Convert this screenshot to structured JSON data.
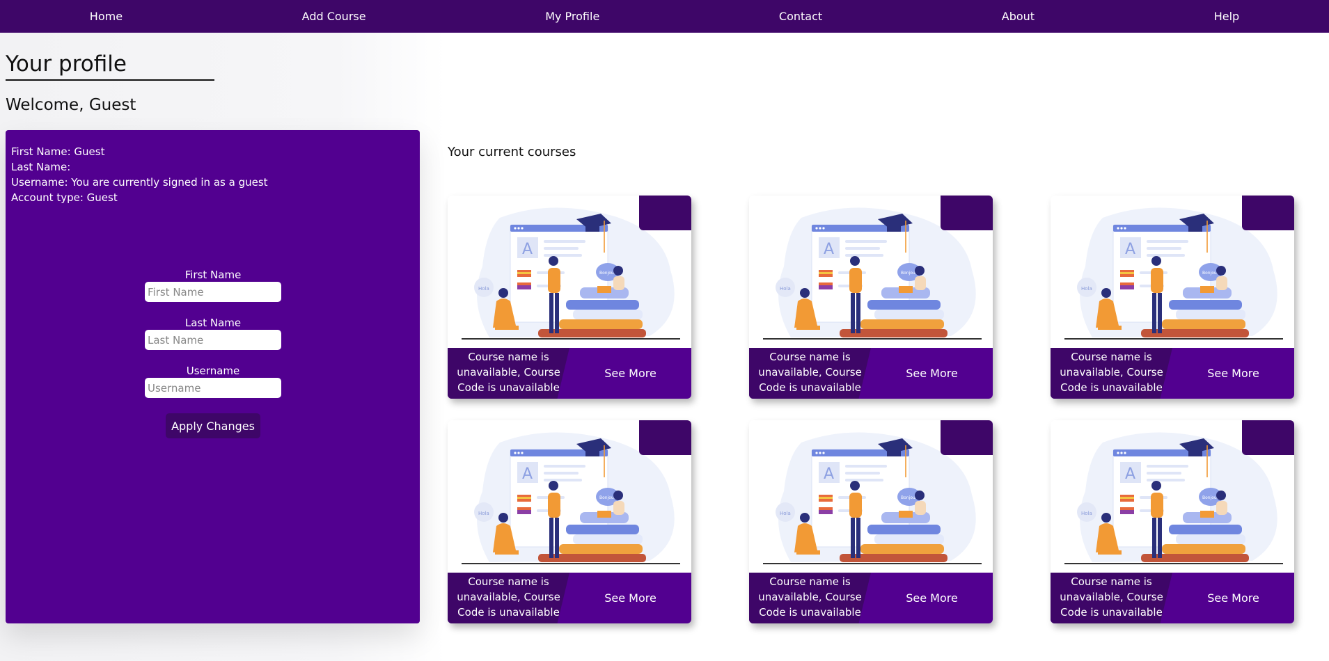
{
  "nav": {
    "items": [
      "Home",
      "Add Course",
      "My Profile",
      "Contact",
      "About",
      "Help"
    ]
  },
  "page": {
    "title": "Your profile",
    "welcome": "Welcome, Guest"
  },
  "profile": {
    "first_name_line": "First Name: Guest",
    "last_name_line": "Last Name:",
    "username_line": "Username: You are currently signed in as a guest",
    "account_type_line": "Account type: Guest",
    "form": {
      "first_name_label": "First Name",
      "first_name_placeholder": "First Name",
      "last_name_label": "Last Name",
      "last_name_placeholder": "Last Name",
      "username_label": "Username",
      "username_placeholder": "Username",
      "apply_label": "Apply Changes"
    }
  },
  "courses": {
    "heading": "Your current courses",
    "cards": [
      {
        "name": "Course name is unavailable, Course Code is unavailable",
        "see_more": "See More"
      },
      {
        "name": "Course name is unavailable, Course Code is unavailable",
        "see_more": "See More"
      },
      {
        "name": "Course name is unavailable, Course Code is unavailable",
        "see_more": "See More"
      },
      {
        "name": "Course name is unavailable, Course Code is unavailable",
        "see_more": "See More"
      },
      {
        "name": "Course name is unavailable, Course Code is unavailable",
        "see_more": "See More"
      },
      {
        "name": "Course name is unavailable, Course Code is unavailable",
        "see_more": "See More"
      }
    ]
  },
  "colors": {
    "nav_bg": "#3e0668",
    "panel_bg": "#520090",
    "accent_dark": "#3e0668"
  }
}
